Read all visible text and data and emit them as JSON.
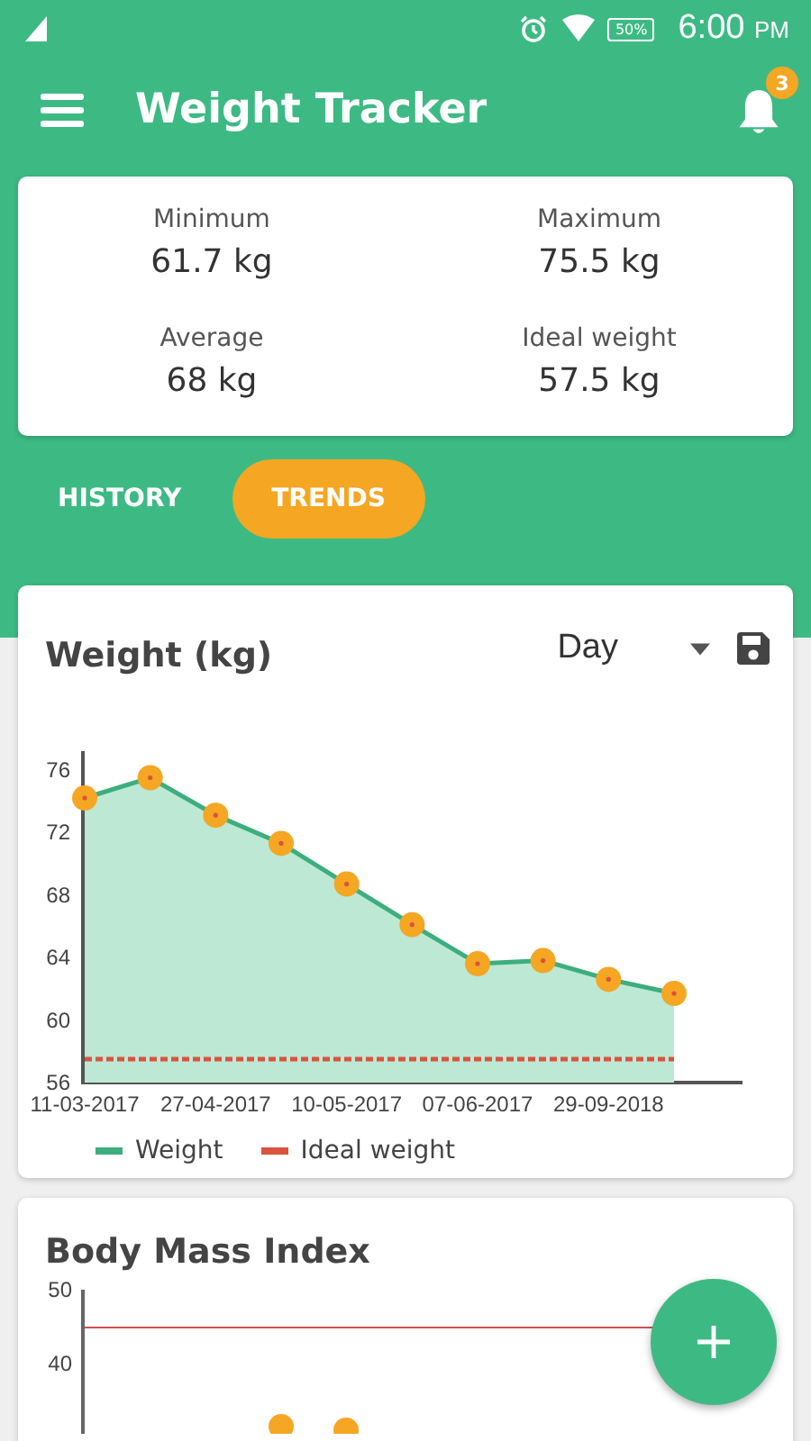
{
  "status_bar": {
    "battery": "50%",
    "time": "6:00",
    "meridiem": "PM"
  },
  "app_bar": {
    "title": "Weight Tracker",
    "notifications": "3"
  },
  "summary": [
    {
      "label": "Minimum",
      "value": "61.7 kg"
    },
    {
      "label": "Maximum",
      "value": "75.5 kg"
    },
    {
      "label": "Average",
      "value": "68 kg"
    },
    {
      "label": "Ideal weight",
      "value": "57.5 kg"
    }
  ],
  "tabs": [
    {
      "label": "HISTORY",
      "selected": false
    },
    {
      "label": "TRENDS",
      "selected": true
    }
  ],
  "weight_card": {
    "title": "Weight (kg)",
    "period": "Day",
    "chart_data": {
      "type": "area",
      "categories": [
        "11-03-2017",
        null,
        "27-04-2017",
        null,
        "10-05-2017",
        null,
        "07-06-2017",
        null,
        "29-09-2018",
        null
      ],
      "ylim": [
        56,
        77.2
      ],
      "yticks": [
        56,
        60,
        64,
        68,
        72,
        76
      ],
      "series": [
        {
          "name": "Weight",
          "type": "area",
          "color": "#3dae7e",
          "values": [
            74.2,
            75.5,
            73.1,
            71.3,
            68.7,
            66.1,
            63.6,
            63.8,
            62.6,
            61.7
          ]
        },
        {
          "name": "Ideal weight",
          "type": "line",
          "line_style": "dashed",
          "color": "#d9533f",
          "values": [
            57.5,
            57.5,
            57.5,
            57.5,
            57.5,
            57.5,
            57.5,
            57.5,
            57.5,
            57.5
          ]
        }
      ]
    }
  },
  "bmi_card": {
    "title": "Body Mass Index",
    "y_labels": [
      "50",
      "40"
    ]
  }
}
